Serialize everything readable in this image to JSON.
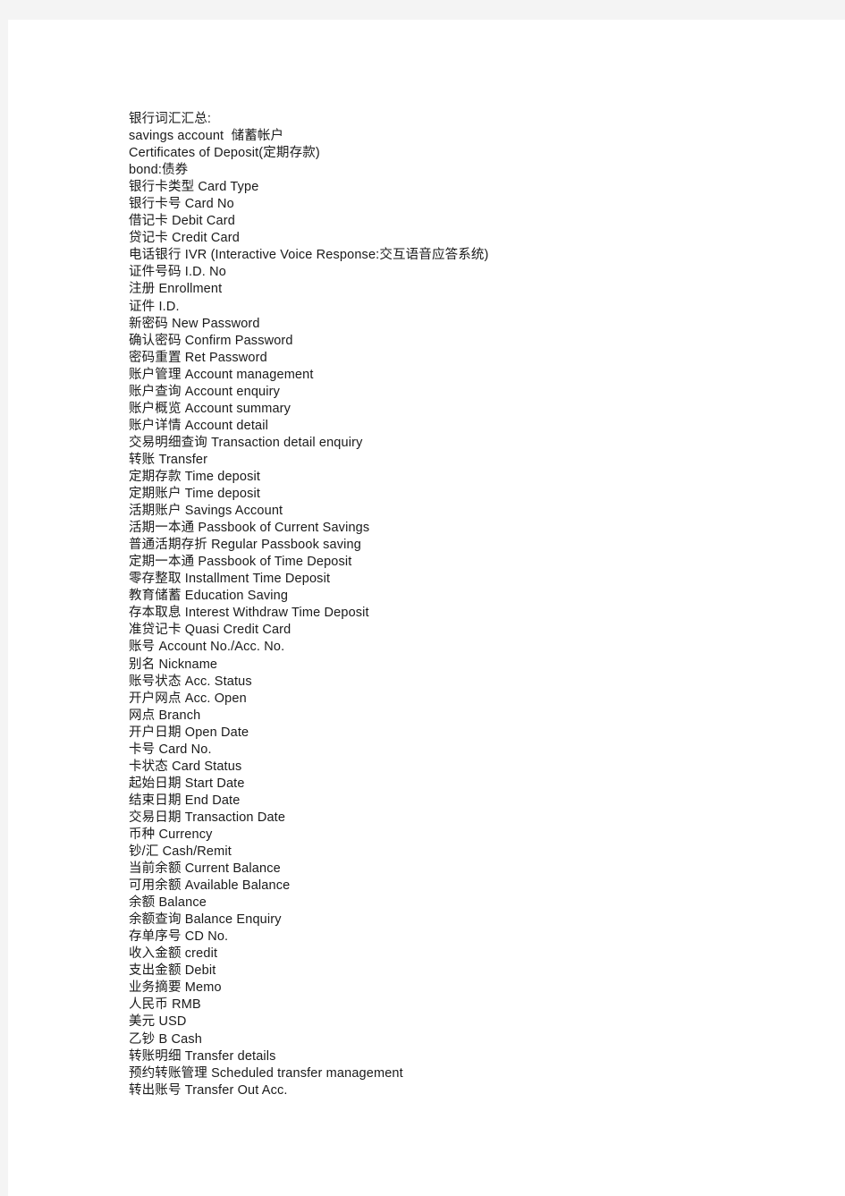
{
  "document": {
    "page_background": "#ffffff",
    "canvas_background": "#f4f4f4",
    "text_color": "#1a1a1a",
    "heading": "银行词汇汇总:",
    "lines": [
      "银行词汇汇总:",
      "savings account  储蓄帐户",
      "Certificates of Deposit(定期存款)",
      "bond:债券",
      "银行卡类型 Card Type",
      "银行卡号 Card No",
      "借记卡 Debit Card",
      "贷记卡 Credit Card",
      "电话银行 IVR (Interactive Voice Response:交互语音应答系统)",
      "证件号码 I.D. No",
      "注册 Enrollment",
      "证件 I.D.",
      "新密码 New Password",
      "确认密码 Confirm Password",
      "密码重置 Ret Password",
      "账户管理 Account management",
      "账户查询 Account enquiry",
      "账户概览 Account summary",
      "账户详情 Account detail",
      "交易明细查询 Transaction detail enquiry",
      "转账 Transfer",
      "定期存款 Time deposit",
      "定期账户 Time deposit",
      "活期账户 Savings Account",
      "活期一本通 Passbook of Current Savings",
      "普通活期存折 Regular Passbook saving",
      "定期一本通 Passbook of Time Deposit",
      "零存整取 Installment Time Deposit",
      "教育储蓄 Education Saving",
      "存本取息 Interest Withdraw Time Deposit",
      "准贷记卡 Quasi Credit Card",
      "账号 Account No./Acc. No.",
      "别名 Nickname",
      "账号状态 Acc. Status",
      "开户网点 Acc. Open",
      "网点 Branch",
      "开户日期 Open Date",
      "卡号 Card No.",
      "卡状态 Card Status",
      "起始日期 Start Date",
      "结束日期 End Date",
      "交易日期 Transaction Date",
      "币种 Currency",
      "钞/汇 Cash/Remit",
      "当前余额 Current Balance",
      "可用余额 Available Balance",
      "余额 Balance",
      "余额查询 Balance Enquiry",
      "存单序号 CD No.",
      "收入金额 credit",
      "支出金额 Debit",
      "业务摘要 Memo",
      "人民币 RMB",
      "美元 USD",
      "乙钞 B Cash",
      "转账明细 Transfer details",
      "预约转账管理 Scheduled transfer management",
      "转出账号 Transfer Out Acc."
    ]
  }
}
